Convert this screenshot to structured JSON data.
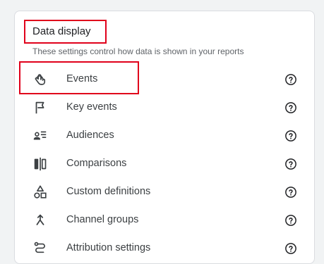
{
  "section": {
    "title": "Data display",
    "subtitle": "These settings control how data is shown in your reports"
  },
  "items": [
    {
      "label": "Events",
      "icon": "touch-icon"
    },
    {
      "label": "Key events",
      "icon": "flag-icon"
    },
    {
      "label": "Audiences",
      "icon": "audience-icon"
    },
    {
      "label": "Comparisons",
      "icon": "comparison-icon"
    },
    {
      "label": "Custom definitions",
      "icon": "shapes-icon"
    },
    {
      "label": "Channel groups",
      "icon": "merge-icon"
    },
    {
      "label": "Attribution settings",
      "icon": "route-icon"
    }
  ],
  "help_icon": "help-circle-icon",
  "colors": {
    "highlight": "#e0001b",
    "icon": "#3c4043",
    "text": "#3c4043",
    "subtext": "#5f6368"
  }
}
